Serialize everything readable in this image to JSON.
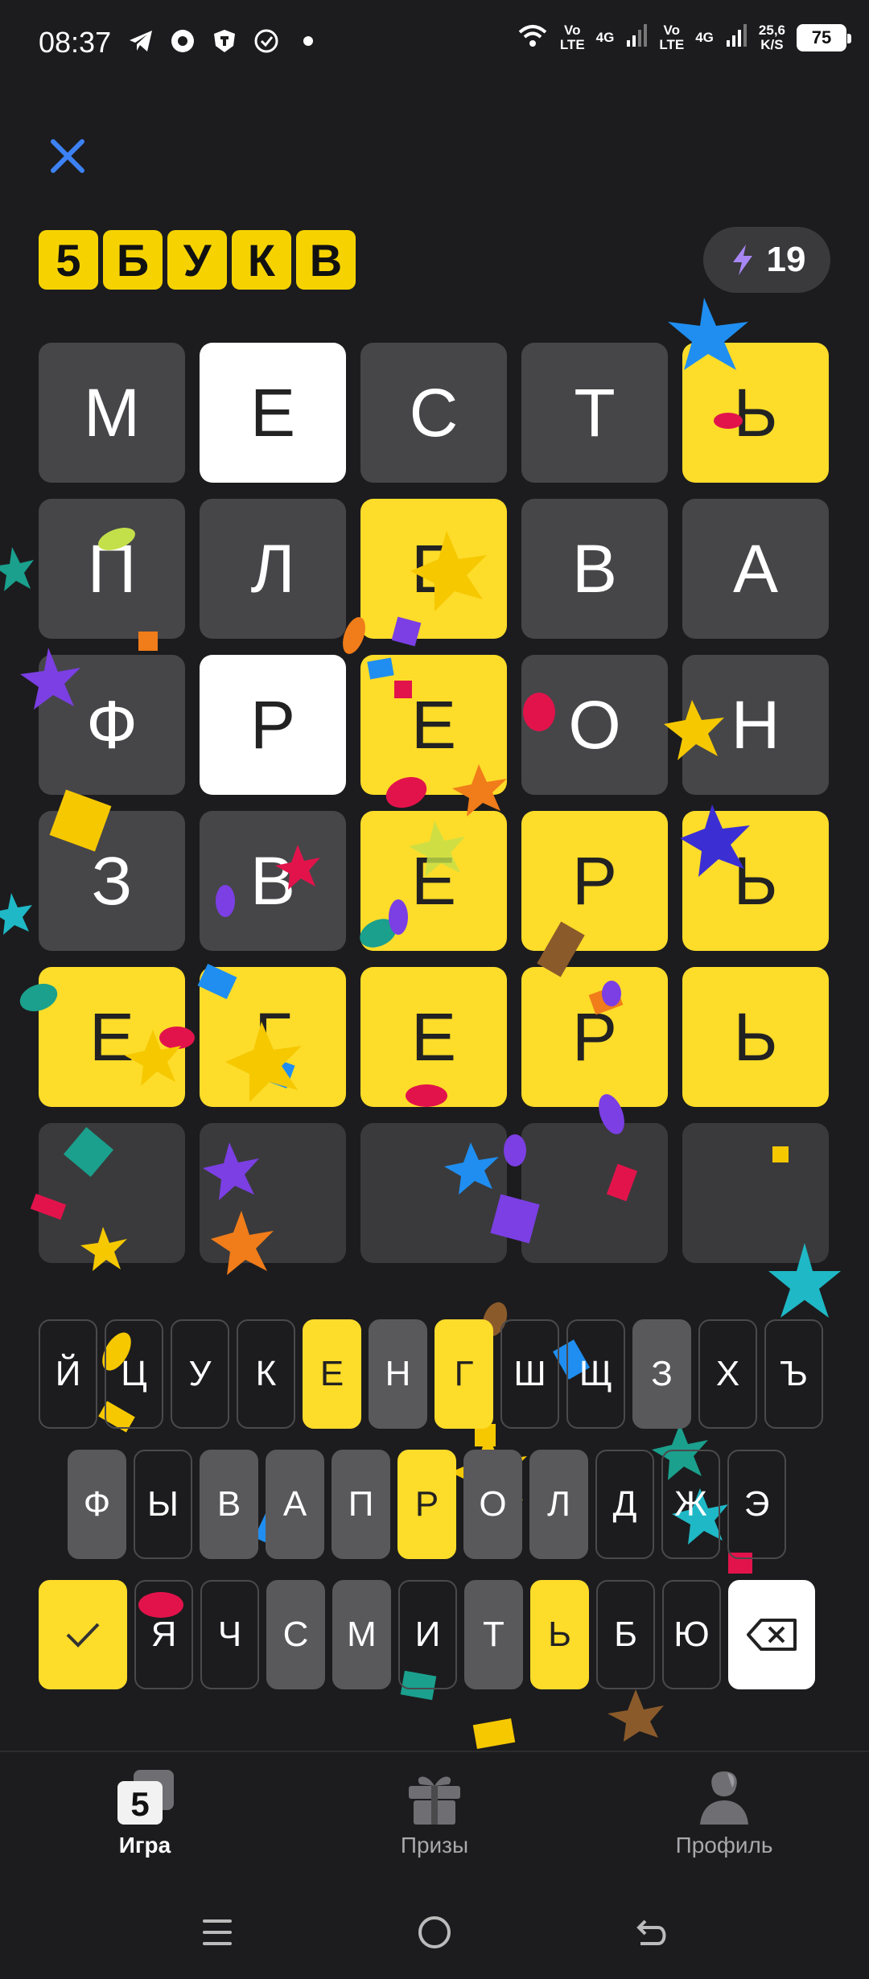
{
  "status_bar": {
    "time": "08:37",
    "icons": [
      "telegram-icon",
      "app-icon",
      "shield-icon",
      "check-circle-icon",
      "dot-icon"
    ],
    "network": {
      "vo1": "Vo",
      "lte1": "LTE",
      "g1": "4G",
      "vo2": "Vo",
      "lte2": "LTE",
      "g2": "4G",
      "speed": "25,6",
      "speed_unit": "K/S"
    },
    "battery": "75"
  },
  "header": {
    "logo_letters": [
      "5",
      "Б",
      "У",
      "К",
      "В"
    ],
    "energy": "19"
  },
  "grid": [
    [
      {
        "l": "М",
        "s": "gray"
      },
      {
        "l": "Е",
        "s": "white"
      },
      {
        "l": "С",
        "s": "gray"
      },
      {
        "l": "Т",
        "s": "gray"
      },
      {
        "l": "Ь",
        "s": "yellow"
      }
    ],
    [
      {
        "l": "П",
        "s": "gray"
      },
      {
        "l": "Л",
        "s": "gray"
      },
      {
        "l": "Е",
        "s": "yellow"
      },
      {
        "l": "В",
        "s": "gray"
      },
      {
        "l": "А",
        "s": "gray"
      }
    ],
    [
      {
        "l": "Ф",
        "s": "gray"
      },
      {
        "l": "Р",
        "s": "white"
      },
      {
        "l": "Е",
        "s": "yellow"
      },
      {
        "l": "О",
        "s": "gray"
      },
      {
        "l": "Н",
        "s": "gray"
      }
    ],
    [
      {
        "l": "З",
        "s": "gray"
      },
      {
        "l": "В",
        "s": "gray"
      },
      {
        "l": "Е",
        "s": "yellow"
      },
      {
        "l": "Р",
        "s": "yellow"
      },
      {
        "l": "Ь",
        "s": "yellow"
      }
    ],
    [
      {
        "l": "Е",
        "s": "yellow"
      },
      {
        "l": "Г",
        "s": "yellow"
      },
      {
        "l": "Е",
        "s": "yellow"
      },
      {
        "l": "Р",
        "s": "yellow"
      },
      {
        "l": "Ь",
        "s": "yellow"
      }
    ],
    [
      {
        "l": "",
        "s": "empty"
      },
      {
        "l": "",
        "s": "empty"
      },
      {
        "l": "",
        "s": "empty"
      },
      {
        "l": "",
        "s": "empty"
      },
      {
        "l": "",
        "s": "empty"
      }
    ]
  ],
  "keyboard": {
    "row1": [
      {
        "l": "Й",
        "s": ""
      },
      {
        "l": "Ц",
        "s": ""
      },
      {
        "l": "У",
        "s": ""
      },
      {
        "l": "К",
        "s": ""
      },
      {
        "l": "Е",
        "s": "yellow"
      },
      {
        "l": "Н",
        "s": "gray"
      },
      {
        "l": "Г",
        "s": "yellow"
      },
      {
        "l": "Ш",
        "s": ""
      },
      {
        "l": "Щ",
        "s": ""
      },
      {
        "l": "З",
        "s": "gray"
      },
      {
        "l": "Х",
        "s": ""
      },
      {
        "l": "Ъ",
        "s": ""
      }
    ],
    "row2": [
      {
        "l": "Ф",
        "s": "gray"
      },
      {
        "l": "Ы",
        "s": ""
      },
      {
        "l": "В",
        "s": "gray"
      },
      {
        "l": "А",
        "s": "gray"
      },
      {
        "l": "П",
        "s": "gray"
      },
      {
        "l": "Р",
        "s": "yellow"
      },
      {
        "l": "О",
        "s": "gray"
      },
      {
        "l": "Л",
        "s": "gray"
      },
      {
        "l": "Д",
        "s": ""
      },
      {
        "l": "Ж",
        "s": ""
      },
      {
        "l": "Э",
        "s": ""
      }
    ],
    "row3": [
      {
        "l": "Я",
        "s": ""
      },
      {
        "l": "Ч",
        "s": ""
      },
      {
        "l": "С",
        "s": "gray"
      },
      {
        "l": "М",
        "s": "gray"
      },
      {
        "l": "И",
        "s": ""
      },
      {
        "l": "Т",
        "s": "gray"
      },
      {
        "l": "Ь",
        "s": "yellow"
      },
      {
        "l": "Б",
        "s": ""
      },
      {
        "l": "Ю",
        "s": ""
      }
    ],
    "enter_icon": "check-icon",
    "backspace_icon": "backspace-icon"
  },
  "bottom_nav": [
    {
      "label": "Игра",
      "icon": "game-5-icon",
      "active": true
    },
    {
      "label": "Призы",
      "icon": "gift-icon",
      "active": false
    },
    {
      "label": "Профиль",
      "icon": "profile-icon",
      "active": false
    }
  ],
  "colors": {
    "background": "#1c1c1e",
    "yellow": "#fddc2a",
    "gray_tile": "#464649",
    "white_tile": "#ffffff",
    "accent_blue": "#3b82f6"
  }
}
